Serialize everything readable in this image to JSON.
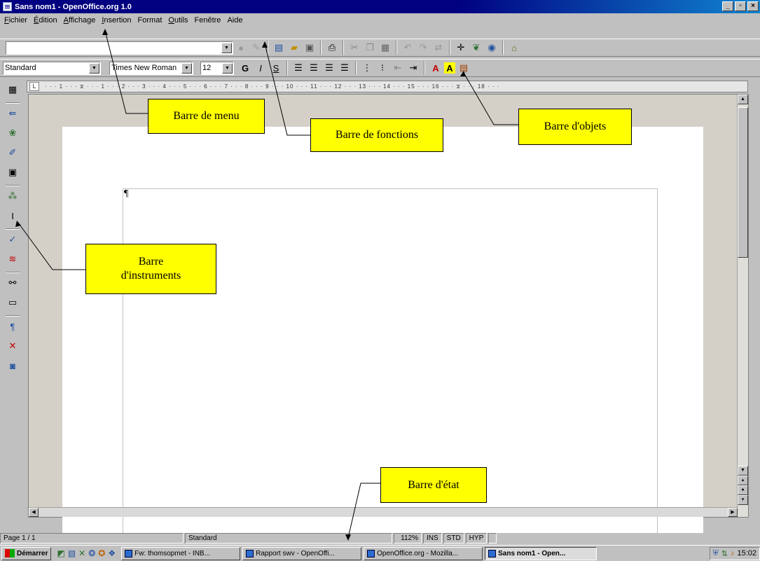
{
  "window": {
    "title": "Sans nom1 - OpenOffice.org 1.0",
    "minimize": "_",
    "maximize": "▫",
    "close": "×"
  },
  "menubar": {
    "items": [
      "Fichier",
      "Édition",
      "Affichage",
      "Insertion",
      "Format",
      "Outils",
      "Fenêtre",
      "Aide"
    ]
  },
  "function_bar": {
    "url_value": ""
  },
  "object_bar": {
    "style": "Standard",
    "font": "Times New Roman",
    "size": "12",
    "bold": "G",
    "italic": "I",
    "underline": "S"
  },
  "ruler": {
    "ticks": "· · · 1 · · · ⧖ · · · 1 · · · 2 · · · 3 · · · 4 · · · 5 · · · 6 · · · 7 · · · 8 · · · 9 · · · 10 · · · 11 · · · 12 · · · 13 · · · 14 · · · 15 · · · 16 · · · ⧖ · · · 18 · · ·"
  },
  "document": {
    "pilcrow": "¶"
  },
  "statusbar": {
    "page": "Page 1 / 1",
    "style": "Standard",
    "zoom": "112%",
    "ins": "INS",
    "std": "STD",
    "hyp": "HYP"
  },
  "taskbar": {
    "start": "Démarrer",
    "tasks": [
      "Fw: thomsopmet - INB...",
      "Rapport swv - OpenOffi...",
      "OpenOffice.org - Mozilla...",
      "Sans nom1 - Open..."
    ],
    "clock": "15:02"
  },
  "callouts": {
    "menu": "Barre de menu",
    "functions": "Barre de fonctions",
    "objects": "Barre d'objets",
    "instruments_line1": "Barre",
    "instruments_line2": "d'instruments",
    "status": "Barre d'état"
  },
  "colors": {
    "callout_bg": "#ffff00",
    "titlebar": "#000080"
  }
}
